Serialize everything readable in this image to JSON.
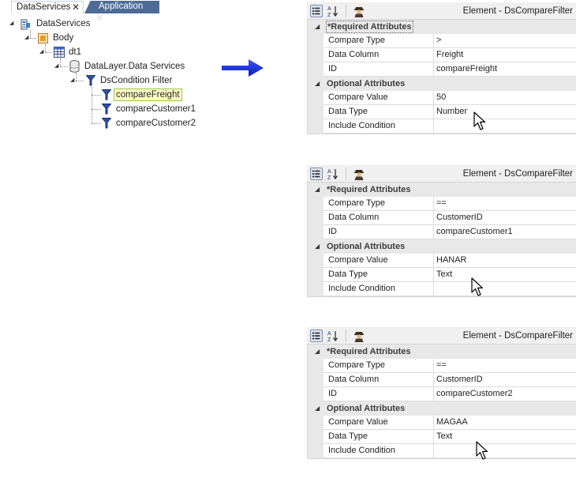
{
  "tabs": [
    {
      "label": "DataServices",
      "active": true
    },
    {
      "label": "Application",
      "active": false
    }
  ],
  "tree": {
    "root": "DataServices",
    "body": "Body",
    "dt1": "dt1",
    "datalayer": "DataLayer.Data Services",
    "condition_filter": "DsCondition Filter",
    "filters": [
      "compareFreight",
      "compareCustomer1",
      "compareCustomer2"
    ],
    "selected": "compareFreight"
  },
  "colors": {
    "arrow": "#1a2fe0",
    "tab_inactive": "#4d6b95",
    "selected_bg": "#ffffc8",
    "selected_border": "#99c34a",
    "category_bg": "#e8e8e8"
  },
  "panels": [
    {
      "title": "Element - DsCompareFilter",
      "required_label": "*Required Attributes",
      "optional_label": "Optional Attributes",
      "required": [
        {
          "name": "Compare Type",
          "value": ">"
        },
        {
          "name": "Data Column",
          "value": "Freight"
        },
        {
          "name": "ID",
          "value": "compareFreight"
        }
      ],
      "optional": [
        {
          "name": "Compare Value",
          "value": "50"
        },
        {
          "name": "Data Type",
          "value": "Number"
        },
        {
          "name": "Include Condition",
          "value": ""
        }
      ]
    },
    {
      "title": "Element - DsCompareFilter",
      "required_label": "*Required Attributes",
      "optional_label": "Optional Attributes",
      "required": [
        {
          "name": "Compare Type",
          "value": "=="
        },
        {
          "name": "Data Column",
          "value": "CustomerID"
        },
        {
          "name": "ID",
          "value": "compareCustomer1"
        }
      ],
      "optional": [
        {
          "name": "Compare Value",
          "value": "HANAR"
        },
        {
          "name": "Data Type",
          "value": "Text"
        },
        {
          "name": "Include Condition",
          "value": ""
        }
      ]
    },
    {
      "title": "Element - DsCompareFilter",
      "required_label": "*Required Attributes",
      "optional_label": "Optional Attributes",
      "required": [
        {
          "name": "Compare Type",
          "value": "=="
        },
        {
          "name": "Data Column",
          "value": "CustomerID"
        },
        {
          "name": "ID",
          "value": "compareCustomer2"
        }
      ],
      "optional": [
        {
          "name": "Compare Value",
          "value": "MAGAA"
        },
        {
          "name": "Data Type",
          "value": "Text"
        },
        {
          "name": "Include Condition",
          "value": ""
        }
      ]
    }
  ]
}
